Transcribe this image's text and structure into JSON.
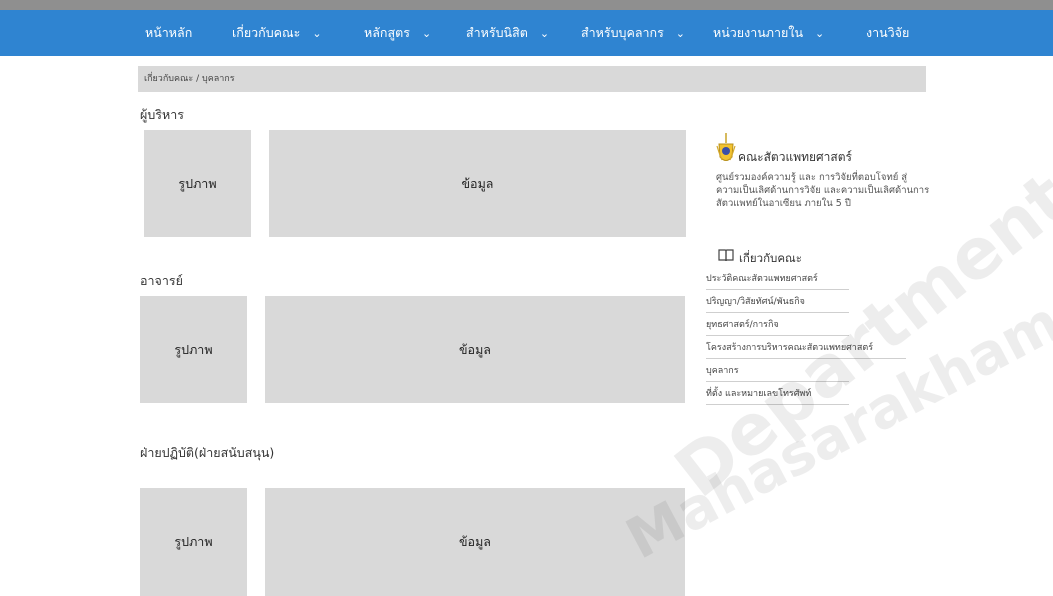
{
  "nav": {
    "items": [
      {
        "label": "หน้าหลัก",
        "dropdown": false
      },
      {
        "label": "เกี่ยวกับคณะ",
        "dropdown": true
      },
      {
        "label": "หลักสูตร",
        "dropdown": true
      },
      {
        "label": "สำหรับนิสิต",
        "dropdown": true
      },
      {
        "label": "สำหรับบุคลากร",
        "dropdown": true
      },
      {
        "label": "หน่วยงานภายใน",
        "dropdown": true
      },
      {
        "label": "งานวิจัย",
        "dropdown": false
      }
    ],
    "chevron": "⌄"
  },
  "breadcrumb": {
    "parent": "เกี่ยวกับคณะ",
    "separator": " / ",
    "current": "บุคลากร"
  },
  "sections": [
    {
      "title": "ผู้บริหาร",
      "photo_label": "รูปภาพ",
      "info_label": "ข้อมูล"
    },
    {
      "title": "อาจารย์",
      "photo_label": "รูปภาพ",
      "info_label": "ข้อมูล"
    },
    {
      "title": "ฝ่ายปฏิบัติ(ฝ่ายสนับสนุน)",
      "photo_label": "รูปภาพ",
      "info_label": "ข้อมูล"
    }
  ],
  "sidebar": {
    "faculty_name": "คณะสัตวแพทยศาสตร์",
    "description": "ศูนย์รวมองค์ความรู้ และ การวิจัยที่ตอบโจทย์ สู่ความเป็นเลิศด้านการวิจัย และความเป็นเลิศด้านการสัตวแพทย์ในอาเซียน ภายใน 5 ปี",
    "about_title": "เกี่ยวกับคณะ",
    "links": [
      "ประวัติคณะสัตวแพทยศาสตร์",
      "ปริญญา/วิสัยทัศน์/พันธกิจ",
      "ยุทธศาสตร์/การกิจ",
      "โครงสร้างการบริหารคณะสัตวแพทยศาสตร์",
      "บุคลากร",
      "ที่ตั้ง และหมายเลขโทรศัพท์"
    ]
  },
  "watermark": {
    "text": "Mahasarakham University",
    "text2": "Department"
  },
  "colors": {
    "nav_bg": "#2f84d1",
    "placeholder_bg": "#d9d9d9",
    "top_strip": "#8f8f8f"
  }
}
